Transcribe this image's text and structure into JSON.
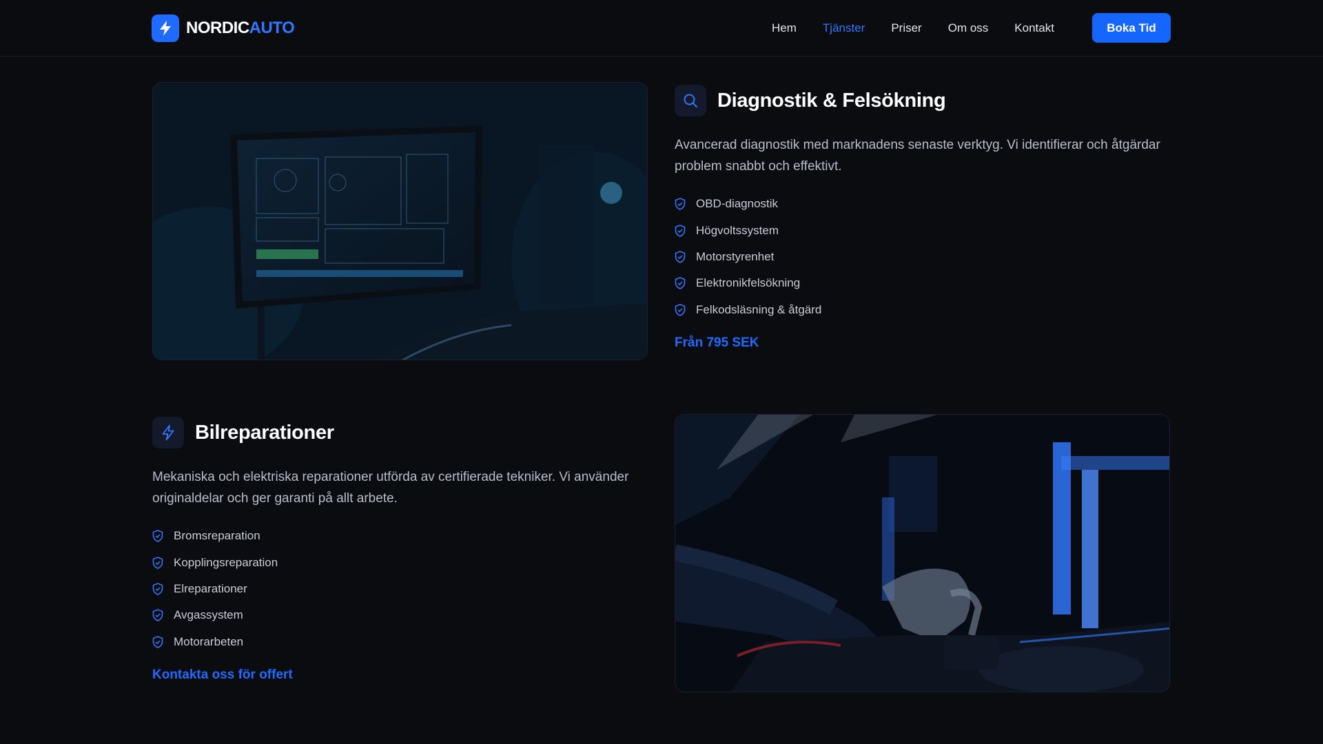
{
  "brand": {
    "name_part1": "NORDIC",
    "name_part2": "AUTO",
    "accent": "#1f6bff"
  },
  "nav": {
    "items": [
      {
        "label": "Hem",
        "active": false
      },
      {
        "label": "Tjänster",
        "active": true
      },
      {
        "label": "Priser",
        "active": false
      },
      {
        "label": "Om oss",
        "active": false
      },
      {
        "label": "Kontakt",
        "active": false
      }
    ],
    "cta_label": "Boka Tid"
  },
  "services": [
    {
      "icon": "search-icon",
      "title": "Diagnostik & Felsökning",
      "description": "Avancerad diagnostik med marknadens senaste verktyg. Vi identifierar och åtgärdar problem snabbt och effektivt.",
      "features": [
        "OBD-diagnostik",
        "Högvoltssystem",
        "Motorstyrenhet",
        "Elektronikfelsökning",
        "Felkodsläsning & åtgärd"
      ],
      "link_label": "Från 795 SEK",
      "image": "diagnostic-monitor-photo"
    },
    {
      "icon": "lightning-icon",
      "title": "Bilreparationer",
      "description": "Mekaniska och elektriska reparationer utförda av certifierade tekniker. Vi använder originaldelar och ger garanti på allt arbete.",
      "features": [
        "Bromsreparation",
        "Kopplingsreparation",
        "Elreparationer",
        "Avgassystem",
        "Motorarbeten"
      ],
      "link_label": "Kontakta oss för offert",
      "image": "mechanic-engine-photo"
    }
  ]
}
